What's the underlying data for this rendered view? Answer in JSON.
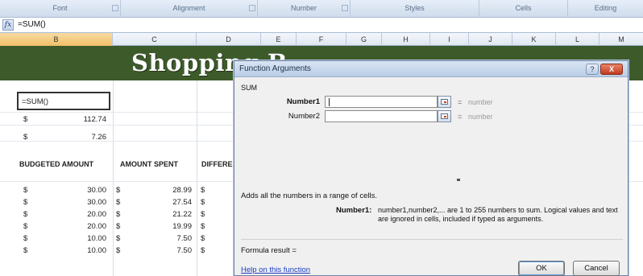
{
  "ribbon": {
    "groups": [
      "Font",
      "Alignment",
      "Number",
      "Styles",
      "Cells",
      "Editing"
    ]
  },
  "formula_bar": {
    "fx_label": "fx",
    "content": "=SUM()"
  },
  "columns": [
    "B",
    "C",
    "D",
    "E",
    "F",
    "G",
    "H",
    "I",
    "J",
    "K",
    "L",
    "M"
  ],
  "sheet": {
    "title": "Shopping B",
    "active_cell": "=SUM()",
    "rows_top": [
      {
        "currency": "$",
        "value": "112.74"
      },
      {
        "currency": "$",
        "value": "7.26"
      }
    ],
    "headers": {
      "budgeted": "BUDGETED AMOUNT",
      "spent": "AMOUNT SPENT",
      "difference": "DIFFERE"
    },
    "data_rows": [
      {
        "b_cur": "$",
        "budgeted": "30.00",
        "c_cur": "$",
        "spent": "28.99",
        "d_cur": "$"
      },
      {
        "b_cur": "$",
        "budgeted": "30.00",
        "c_cur": "$",
        "spent": "27.54",
        "d_cur": "$"
      },
      {
        "b_cur": "$",
        "budgeted": "20.00",
        "c_cur": "$",
        "spent": "21.22",
        "d_cur": "$"
      },
      {
        "b_cur": "$",
        "budgeted": "20.00",
        "c_cur": "$",
        "spent": "19.99",
        "d_cur": "$"
      },
      {
        "b_cur": "$",
        "budgeted": "10.00",
        "c_cur": "$",
        "spent": "7.50",
        "d_cur": "$"
      },
      {
        "b_cur": "$",
        "budgeted": "10.00",
        "c_cur": "$",
        "spent": "7.50",
        "d_cur": "$"
      }
    ]
  },
  "dialog": {
    "title": "Function Arguments",
    "help_glyph": "?",
    "close_glyph": "X",
    "function_name": "SUM",
    "args": [
      {
        "label": "Number1",
        "equals": "=",
        "value": "number"
      },
      {
        "label": "Number2",
        "equals": "=",
        "value": "number"
      }
    ],
    "description": "Adds all the numbers in a range of cells.",
    "arg_help_label": "Number1:",
    "arg_help_text": "number1,number2,... are 1 to 255 numbers to sum. Logical values and text are ignored in cells, included if typed as arguments.",
    "formula_result": "Formula result =",
    "help_link": "Help on this function",
    "ok_label": "OK",
    "cancel_label": "Cancel"
  },
  "colors": {
    "title_band": "#3d5a2b",
    "selection_header": "#f2c068",
    "dialog_close": "#c13a1e",
    "link": "#1a3ec2"
  }
}
